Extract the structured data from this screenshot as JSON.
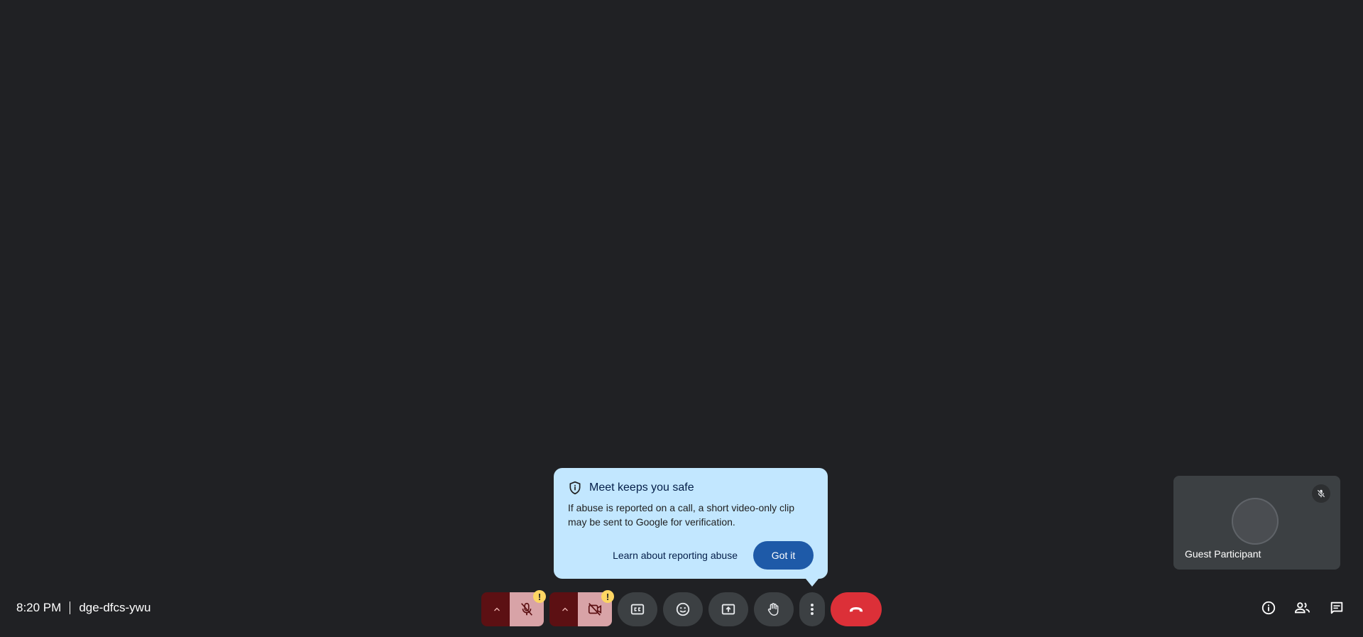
{
  "popup": {
    "title": "Meet keeps you safe",
    "body": "If abuse is reported on a call, a short video-only clip may be sent to Google for verification.",
    "learn_label": "Learn about reporting abuse",
    "got_it_label": "Got it"
  },
  "tile": {
    "name": "Guest Participant"
  },
  "meeting": {
    "time": "8:20 PM",
    "code": "dge-dfcs-ywu"
  },
  "controls": {
    "mic_warning": "!",
    "camera_warning": "!"
  },
  "icons": {
    "shield": "shield-icon",
    "mic_off": "mic-off-icon",
    "camera_off": "camera-off-icon",
    "captions": "closed-captions-icon",
    "emoji": "emoji-icon",
    "present": "present-screen-icon",
    "raise_hand": "hand-icon",
    "more": "more-vert-icon",
    "leave": "call-end-icon",
    "info": "info-icon",
    "people": "people-icon",
    "chat": "chat-icon"
  },
  "colors": {
    "background": "#202124",
    "popup_bg": "#c2e7ff",
    "primary_button": "#1e5aa8",
    "muted_button": "#d8a3a7",
    "leave_button": "#dc3038",
    "warning_badge": "#fdd663"
  }
}
